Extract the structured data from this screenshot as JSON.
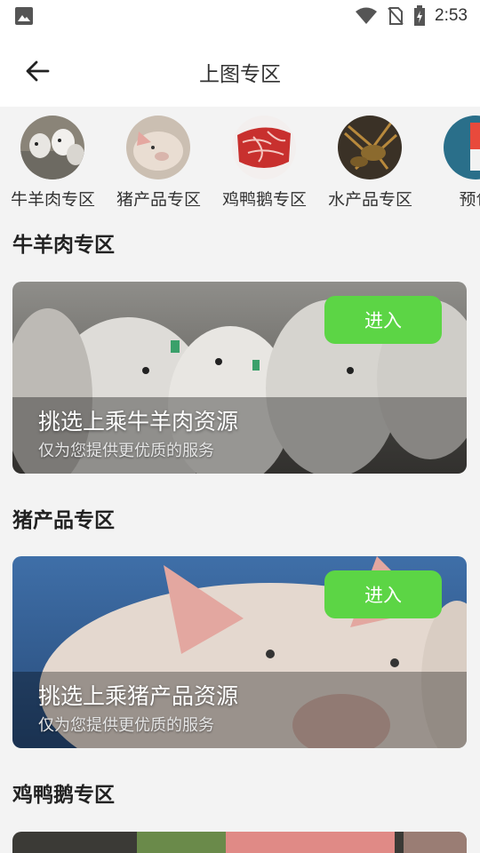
{
  "status": {
    "time": "2:53",
    "icons": [
      "image-icon",
      "wifi-icon",
      "no-sim-icon",
      "battery-charging-icon"
    ]
  },
  "appbar": {
    "title": "上图专区",
    "back_icon": "arrow-left-icon"
  },
  "categories": [
    {
      "label": "牛羊肉专区",
      "image": "cattle"
    },
    {
      "label": "猪产品专区",
      "image": "pig"
    },
    {
      "label": "鸡鸭鹅专区",
      "image": "raw-meat"
    },
    {
      "label": "水产品专区",
      "image": "lobster"
    },
    {
      "label": "预包",
      "image": "packaged"
    }
  ],
  "sections": [
    {
      "title": "牛羊肉专区",
      "card_title": "挑选上乘牛羊肉资源",
      "card_subtitle": "仅为您提供更优质的服务",
      "button": "进入"
    },
    {
      "title": "猪产品专区",
      "card_title": "挑选上乘猪产品资源",
      "card_subtitle": "仅为您提供更优质的服务",
      "button": "进入"
    },
    {
      "title": "鸡鸭鹅专区"
    }
  ],
  "colors": {
    "accent": "#5cd545",
    "background": "#f3f3f3"
  }
}
